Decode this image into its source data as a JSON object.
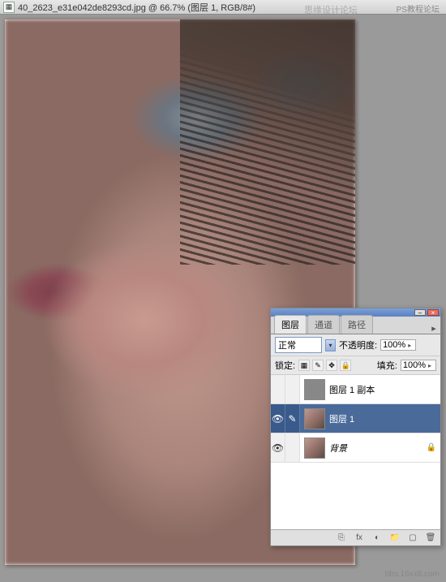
{
  "document": {
    "tab_title": "40_2623_e31e042de8293cd.jpg @ 66.7% (图层 1, RGB/8#)"
  },
  "watermarks": {
    "top_right": "PS教程论坛",
    "mid": "思缘设计论坛",
    "bottom_right": "bbs.16xx8.com"
  },
  "panel": {
    "tabs": {
      "layers": "图层",
      "channels": "通道",
      "paths": "路径"
    },
    "blend_mode_label": "正常",
    "opacity_label": "不透明度:",
    "opacity_value": "100%",
    "lock_label": "锁定:",
    "fill_label": "填充:",
    "fill_value": "100%",
    "layers": [
      {
        "name": "图层 1 副本",
        "visible": false,
        "selected": false,
        "locked": false,
        "thumb": "gray",
        "italic": false
      },
      {
        "name": "图层 1",
        "visible": true,
        "selected": true,
        "locked": false,
        "thumb": "photo",
        "italic": false
      },
      {
        "name": "背景",
        "visible": true,
        "selected": false,
        "locked": true,
        "thumb": "photo",
        "italic": true
      }
    ]
  },
  "icons": {
    "eye": "👁",
    "lock": "🔒",
    "chevron": "▾",
    "right": "▸",
    "menu": "≡",
    "trash": "🗑",
    "new": "▢",
    "folder": "📁",
    "mask": "◐",
    "fx": "fx",
    "link": "⎘",
    "checker": "▦",
    "brush": "✎",
    "move": "✥",
    "minimize": "–",
    "close": "×",
    "doc": "▦"
  }
}
